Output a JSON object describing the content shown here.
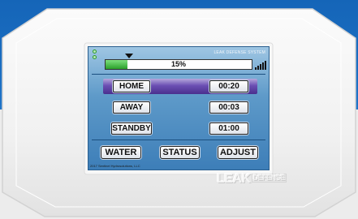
{
  "header": {
    "system_title": "LEAK DEFENSE SYSTEM",
    "level_percent_text": "15%",
    "level_fraction": 0.15
  },
  "modes": [
    {
      "label": "HOME",
      "time": "00:20",
      "selected": true
    },
    {
      "label": "AWAY",
      "time": "00:03",
      "selected": false
    },
    {
      "label": "STANDBY",
      "time": "01:00",
      "selected": false
    }
  ],
  "nav": {
    "water_label": "WATER",
    "status_label": "STATUS",
    "adjust_label": "ADJUST"
  },
  "footer": {
    "copyright": "2017 Sentinel Hydrosolutions, LLC"
  },
  "logo": {
    "primary": "LEAK",
    "secondary": "DEFENSE"
  },
  "colors": {
    "background_blue": "#1565b8",
    "screen_blue": "#5e9ac9",
    "selected_row": "#6b4fb3",
    "level_fill": "#2aa02a"
  }
}
